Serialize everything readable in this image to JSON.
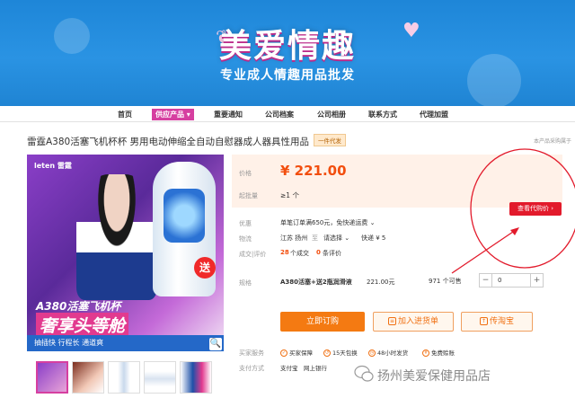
{
  "banner": {
    "title": "美爱情趣",
    "subtitle": "专业成人情趣用品批发"
  },
  "nav": {
    "items": [
      {
        "label": "首页"
      },
      {
        "label": "供应产品 ▾"
      },
      {
        "label": "重要通知"
      },
      {
        "label": "公司档案"
      },
      {
        "label": "公司相册"
      },
      {
        "label": "联系方式"
      },
      {
        "label": "代理加盟"
      }
    ]
  },
  "product": {
    "title": "雷霆A380活塞飞机杯杯 男用电动伸缩全自动自慰器成人器具性用品",
    "tag": "一件代发",
    "corner_text": "本产品采购属于",
    "photo": {
      "brand": "leten 雷霆",
      "gift": "送",
      "model_name": "A380活塞飞机杯",
      "slogan": "奢享头等舱",
      "bar": "抽插快 行程长 通道爽"
    }
  },
  "pricing": {
    "price_label": "价格",
    "price": "¥ 221.00",
    "min_label": "起批量",
    "min_value": "≥1 个",
    "agent_button": "查看代购价 ›"
  },
  "details": {
    "promo_label": "优惠",
    "promo_value": "单笔订单满650元，免快递运费 ⌄",
    "shipping_label": "物流",
    "shipping_from": "江苏 扬州",
    "shipping_to_word": "至",
    "shipping_to": "请选择 ⌄",
    "shipping_method": "快递 ¥ 5",
    "trade_label": "成交|评价",
    "deals": "28",
    "deals_unit": "个成交",
    "reviews": "0",
    "reviews_unit": "条评价",
    "spec_label": "规格",
    "spec_name": "A380活塞+送2瓶润滑液",
    "spec_price": "221.00元",
    "stock": "971 个可售",
    "quantity": "0",
    "minus": "−",
    "plus": "+"
  },
  "actions": {
    "order": "立即订购",
    "cart": "加入进货单",
    "taobao": "传淘宝"
  },
  "services": {
    "buyer_label": "买家服务",
    "items": [
      {
        "label": "买家保障"
      },
      {
        "label": "15天包换"
      },
      {
        "label": "48小时发货"
      },
      {
        "label": "免费赊账"
      }
    ],
    "payment_label": "支付方式",
    "payments": [
      {
        "label": "支付宝"
      },
      {
        "label": "网上银行"
      }
    ]
  },
  "watermark": "扬州美爱保健用品店",
  "colors": {
    "banner_blue": "#2a93e3",
    "accent_pink": "#d63fa0",
    "price_orange": "#f24e0e",
    "annotation_red": "#e21a2b"
  }
}
